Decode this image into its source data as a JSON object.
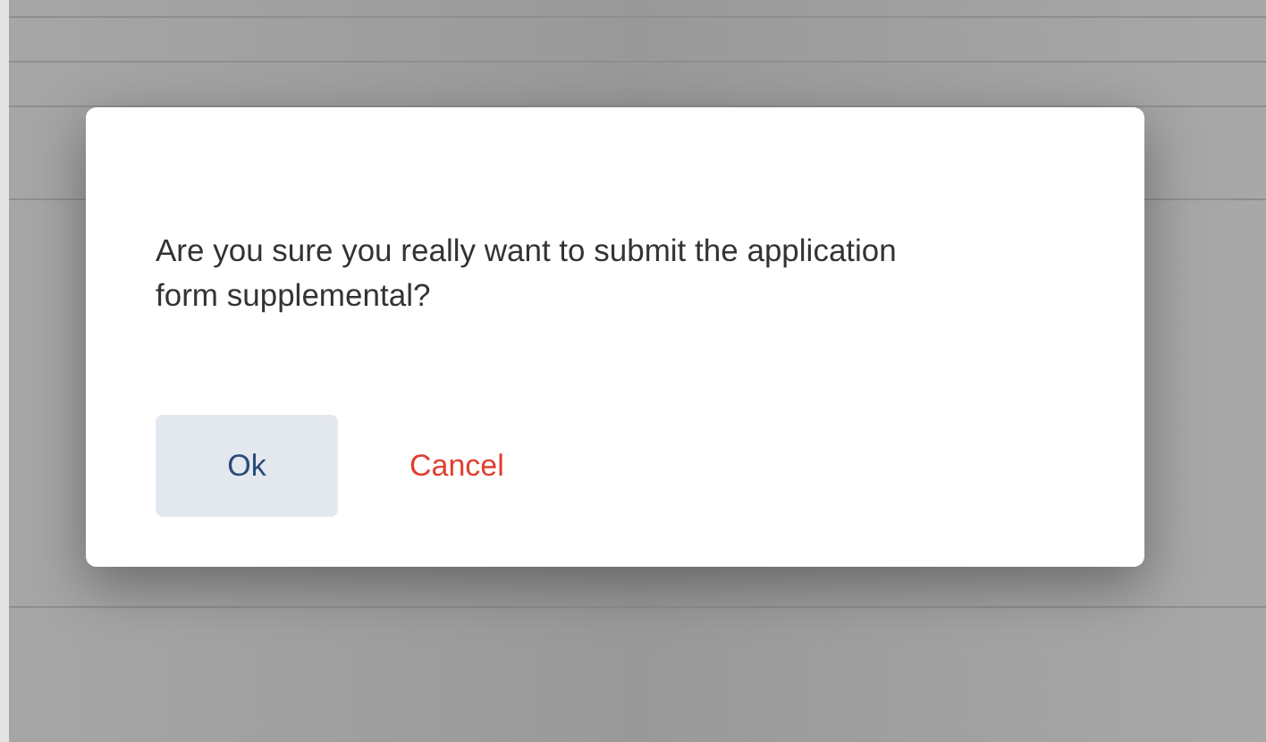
{
  "dialog": {
    "message": "Are you sure you really want to submit the application form supplemental?",
    "buttons": [
      {
        "label": "Ok",
        "kind": "primary"
      },
      {
        "label": "Cancel",
        "kind": "danger"
      }
    ]
  }
}
